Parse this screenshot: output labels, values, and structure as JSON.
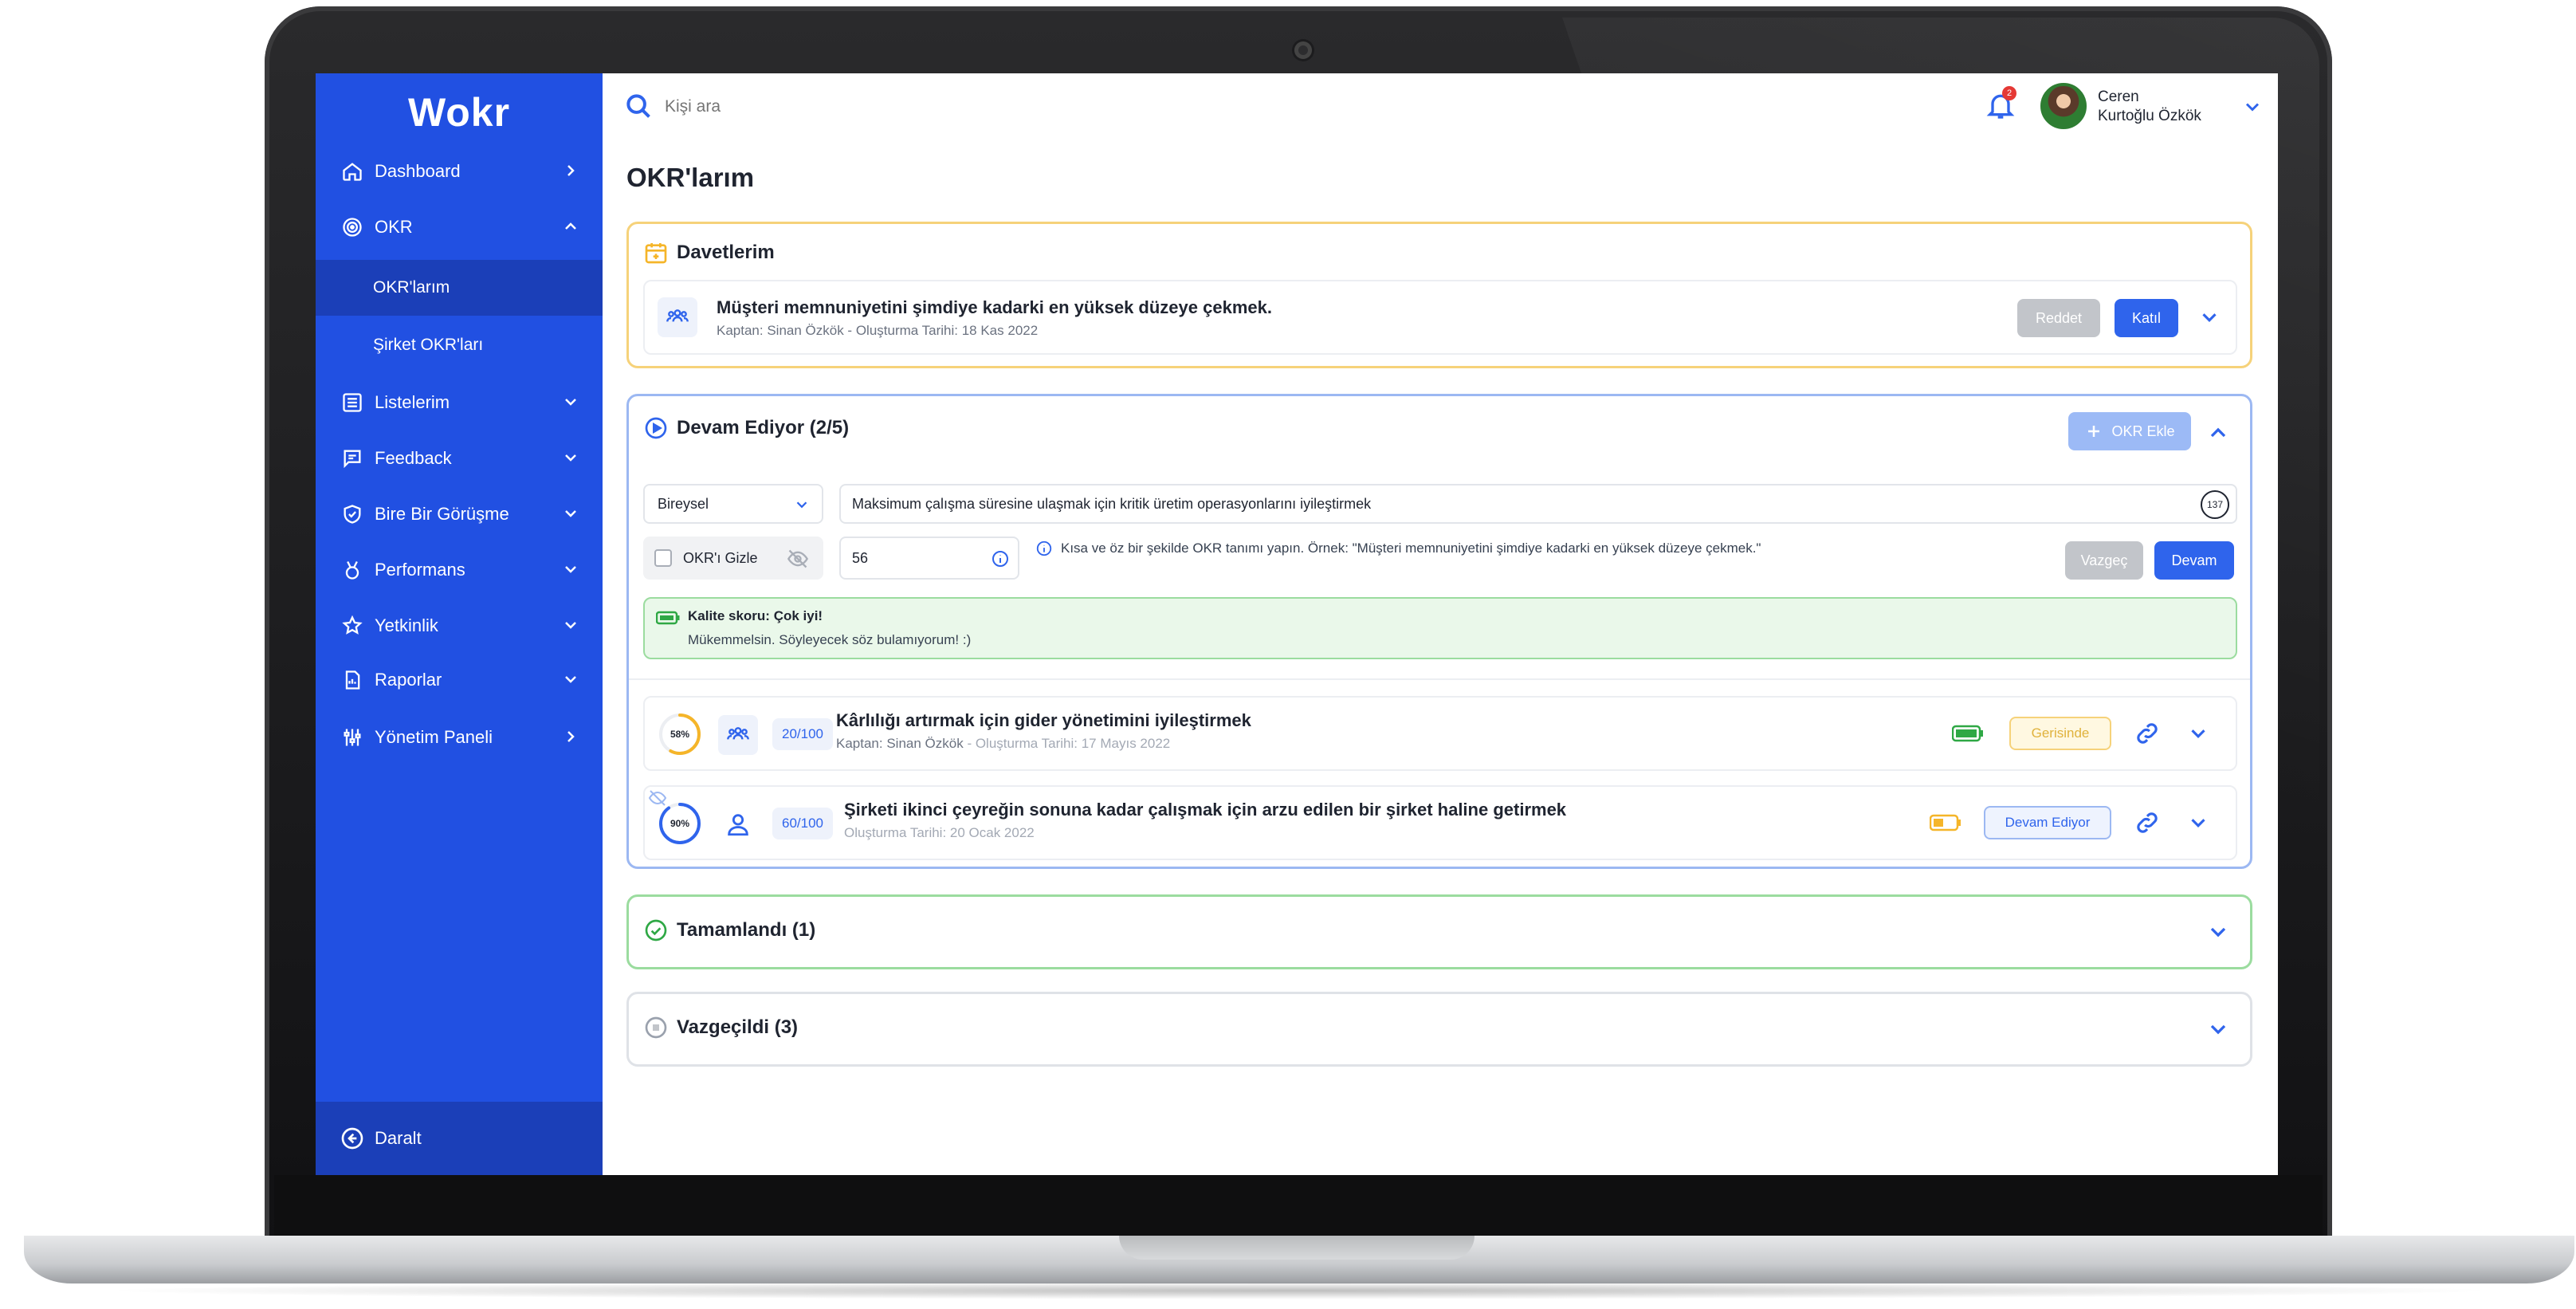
{
  "brand": "Wokr",
  "sidebar": {
    "items": [
      {
        "label": "Dashboard"
      },
      {
        "label": "OKR"
      },
      {
        "label": "OKR'larım"
      },
      {
        "label": "Şirket OKR'ları"
      },
      {
        "label": "Listelerim"
      },
      {
        "label": "Feedback"
      },
      {
        "label": "Bire Bir Görüşme"
      },
      {
        "label": "Performans"
      },
      {
        "label": "Yetkinlik"
      },
      {
        "label": "Raporlar"
      },
      {
        "label": "Yönetim Paneli"
      }
    ],
    "collapse_label": "Daralt"
  },
  "topbar": {
    "search_placeholder": "Kişi ara",
    "notification_count": "2",
    "user_first": "Ceren",
    "user_last": "Kurtoğlu Özkök"
  },
  "page_title": "OKR'larım",
  "invites": {
    "title": "Davetlerim",
    "item": {
      "title": "Müşteri memnuniyetini şimdiye kadarki en yüksek düzeye çekmek.",
      "meta": "Kaptan: Sinan Özkök - Oluşturma Tarihi: 18 Kas 2022"
    },
    "reject_label": "Reddet",
    "join_label": "Katıl"
  },
  "in_progress": {
    "title": "Devam Ediyor (2/5)",
    "add_label": "OKR Ekle",
    "form": {
      "type_value": "Bireysel",
      "text_value": "Maksimum çalışma süresine ulaşmak için kritik üretim operasyonlarını iyileştirmek",
      "char_count": "137",
      "hide_label": "OKR'ı Gizle",
      "number_value": "56",
      "hint": "Kısa ve öz bir şekilde OKR tanımı yapın. Örnek: \"Müşteri memnuniyetini şimdiye kadarki en yüksek düzeye çekmek.\"",
      "cancel_label": "Vazgeç",
      "continue_label": "Devam"
    },
    "quality": {
      "title": "Kalite skoru: Çok iyi!",
      "text": "Mükemmelsin. Söyleyecek söz bulamıyorum! :)"
    },
    "okrs": [
      {
        "progress_label": "58%",
        "progress": 0.58,
        "score": "20/100",
        "title": "Kârlılığı artırmak için gider yönetimini iyileştirmek",
        "captain": "Kaptan: Sinan Özkök",
        "date": " - Oluşturma Tarihi: 17 Mayıs 2022",
        "status": "Gerisinde",
        "color": "#f5b529"
      },
      {
        "progress_label": "90%",
        "progress": 0.9,
        "score": "60/100",
        "title": "Şirketi ikinci çeyreğin sonuna kadar çalışmak için arzu edilen bir şirket haline getirmek",
        "date": "Oluşturma Tarihi: 20 Ocak 2022",
        "status": "Devam Ediyor",
        "color": "#2f64ec"
      }
    ]
  },
  "completed": {
    "title": "Tamamlandı (1)"
  },
  "cancelled": {
    "title": "Vazgeçildi (3)"
  },
  "colors": {
    "sidebar": "#2150e2",
    "primary": "#2f64ec",
    "warning": "#f6d27a",
    "success": "#9bdc9f"
  }
}
